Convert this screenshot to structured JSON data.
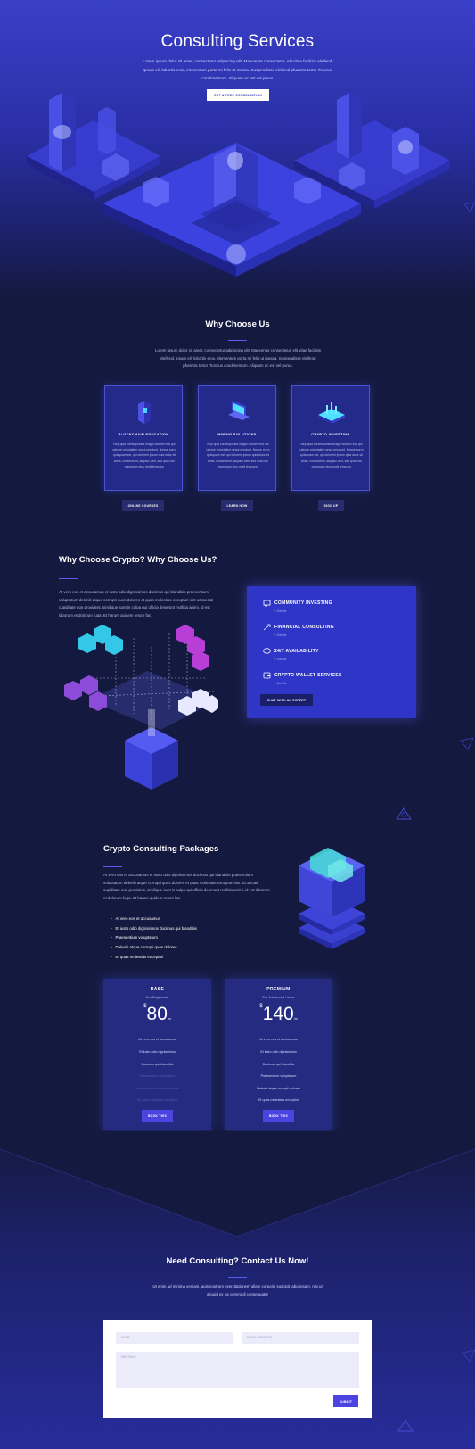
{
  "hero": {
    "title": "Consulting Services",
    "text": "Lorem ipsum dolor sit amet, consectetur adipiscing elit. Maecenas consectetur, elit vitae facilisis eleifend, ipsum elit lobortis eros, elementum porta mi felis ut massa. Suspendisse eleifend pharetra tortor rhoncus condimentum. Aliquam ac est vel purus.",
    "button": "GET A FREE CONSULTATION"
  },
  "why": {
    "title": "Why Choose Us",
    "text": "Lorem ipsum dolor sit amet, consectetur adipiscing elit. Maecenas consectetur, elit vitae facilisis eleifend, ipsum elit lobortis eros, elementum porta mi felis ut massa. Suspendisse eleifend pharetra tortor rhoncus condimentum. Aliquam ac est vel purus.",
    "cards": [
      {
        "title": "BLOCKCHAIN EDUCATION",
        "text": "Nep quia consequuntur magni dolores eos qui ratione voluptatem sequi nesciunt. Neque porro quisquam est, qui dolorem ipsum quia dolor sit amet, consectetur, adipisci velit, sed quia non numquam eius modi tempora.",
        "button": "ONLINE COURSES",
        "icon": "blockchain-icon"
      },
      {
        "title": "MINING SOLUTIONS",
        "text": "Nep quia consequuntur magni dolores eos qui ratione voluptatem sequi nesciunt. Neque porro quisquam est, qui dolorem ipsum quia dolor sit amet, consectetur, adipisci velit, sed quia non numquam eius modi tempora.",
        "button": "LEARN HOW",
        "icon": "laptop-icon"
      },
      {
        "title": "CRYPTO INVESTING",
        "text": "Nep quia consequuntur magni dolores eos qui ratione voluptatem sequi nesciunt. Neque porro quisquam est, qui dolorem ipsum quia dolor sit amet, consectetur, adipisci velit, sed quia non numquam eius modi tempora.",
        "button": "SIGN UP",
        "icon": "chart-platform-icon"
      }
    ]
  },
  "crypto": {
    "title": "Why Choose Crypto? Why Choose Us?",
    "text": "At vero eos et accusamus et iusto odio dignissimos ducimus qui blanditiis praesentium voluptatum deleniti atque corrupti quos dolores et quas molestias excepturi sint occaecati cupiditate non provident, similique sunt in culpa qui officia deserunt mollitia animi, id est laborum et dolorum fuga. Et harum quidem rerum fac",
    "services": [
      {
        "label": "COMMUNITY INVESTING",
        "sub": "+ Details",
        "icon": "community-icon"
      },
      {
        "label": "FINANCIAL CONSULTING",
        "sub": "+ Details",
        "icon": "arrows-icon"
      },
      {
        "label": "24/7 AVAILABILITY",
        "sub": "+ Details",
        "icon": "chat-icon"
      },
      {
        "label": "CRYPTO WALLET SERVICES",
        "sub": "+ Details",
        "icon": "wallet-icon"
      }
    ],
    "button": "CHAT WITH AN EXPERT"
  },
  "packages": {
    "title": "Crypto Consulting Packages",
    "text": "At vero eos et accusamus et iusto odio dignissimos ducimus qui blanditiis praesentium voluptatum deleniti atque corrupti quos dolores et quas molestias excepturi sint occaecati cupiditate non provident, similique sunt in culpa qui officia deserunt mollitia animi, id est laborum et dolorum fuga. Et harum quidem rerum fac",
    "list": [
      "At vero eos et accusamus",
      "Et iusto odio dignissimos ducimus qui blanditiis",
      "Praesentium voluptatum",
      "Deleniti atque corrupti quos dolores",
      "Et quas molestias excepturi"
    ],
    "plans": [
      {
        "name": "BASE",
        "sub": "For Beginners",
        "currency": "$",
        "price": "80",
        "per": "/m",
        "features": [
          "At vero eos et accusamus",
          "Et iusto odio dignissimos",
          "Ducimus qui blanditiis",
          "Praesentium voluptatum",
          "Deleniti atque corrupti dolores",
          "Et quas molestias excepturi"
        ],
        "disabled": [
          false,
          false,
          false,
          true,
          true,
          true
        ],
        "button": "BOOK THIS"
      },
      {
        "name": "PREMIUM",
        "sub": "For Advanced Users",
        "currency": "$",
        "price": "140",
        "per": "/m",
        "features": [
          "At vero eos et accusamus",
          "Et iusto odio dignissimos",
          "Ducimus qui blanditiis",
          "Praesentium voluptatum",
          "Deleniti atque corrupti dolores",
          "Et quas molestias excepturi"
        ],
        "disabled": [
          false,
          false,
          false,
          false,
          false,
          false
        ],
        "button": "BOOK THIS"
      }
    ]
  },
  "contact": {
    "title": "Need Consulting? Contact Us Now!",
    "text": "Ut enim ad minima veniam, quis nostrum exercitationem ullam corporis suscipit laboriosam, nisi ut aliquid ex ea commodi consequatur",
    "name_placeholder": "NAME",
    "email_placeholder": "EMAIL ADDRESS",
    "message_placeholder": "MESSAGE",
    "submit": "SUBMIT"
  },
  "colors": {
    "accent": "#5a5cf0",
    "panel": "#2f35c6",
    "background": "#141a3f"
  }
}
